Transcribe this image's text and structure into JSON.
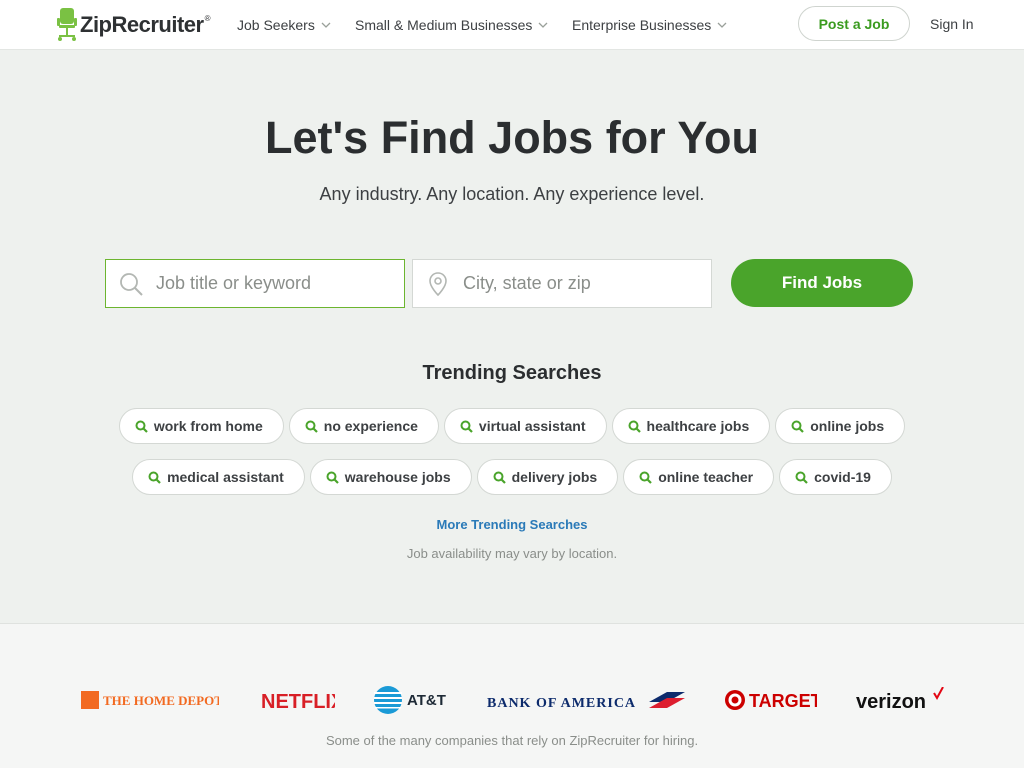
{
  "header": {
    "logo_text": "ZipRecruiter",
    "nav": [
      {
        "label": "Job Seekers"
      },
      {
        "label": "Small & Medium Businesses"
      },
      {
        "label": "Enterprise Businesses"
      }
    ],
    "post_job_label": "Post a Job",
    "sign_in_label": "Sign In"
  },
  "hero": {
    "title": "Let's Find Jobs for You",
    "subtitle": "Any industry. Any location. Any experience level."
  },
  "search": {
    "keyword_placeholder": "Job title or keyword",
    "keyword_value": "",
    "location_placeholder": "City, state or zip",
    "location_value": "",
    "submit_label": "Find Jobs"
  },
  "trending": {
    "title": "Trending Searches",
    "row1": [
      "work from home",
      "no experience",
      "virtual assistant",
      "healthcare jobs",
      "online jobs"
    ],
    "row2": [
      "medical assistant",
      "warehouse jobs",
      "delivery jobs",
      "online teacher",
      "covid-19"
    ],
    "more_label": "More Trending Searches",
    "note": "Job availability may vary by location."
  },
  "companies": {
    "names": [
      "THE HOME DEPOT",
      "NETFLIX",
      "AT&T",
      "BANK OF AMERICA",
      "TARGET",
      "verizon"
    ],
    "caption": "Some of the many companies that rely on ZipRecruiter for hiring."
  },
  "colors": {
    "brand_green": "#4aa42b",
    "link_blue": "#2a7ab8",
    "home_depot_orange": "#f26a21",
    "netflix_red": "#d81f26",
    "att_blue": "#1a9ad6",
    "boa_navy": "#0d2b6c",
    "target_red": "#cc0000",
    "verizon_red": "#e30613"
  },
  "icons": {
    "search": "magnifier-icon",
    "location": "map-pin-icon",
    "chevron": "chevron-down-icon"
  }
}
